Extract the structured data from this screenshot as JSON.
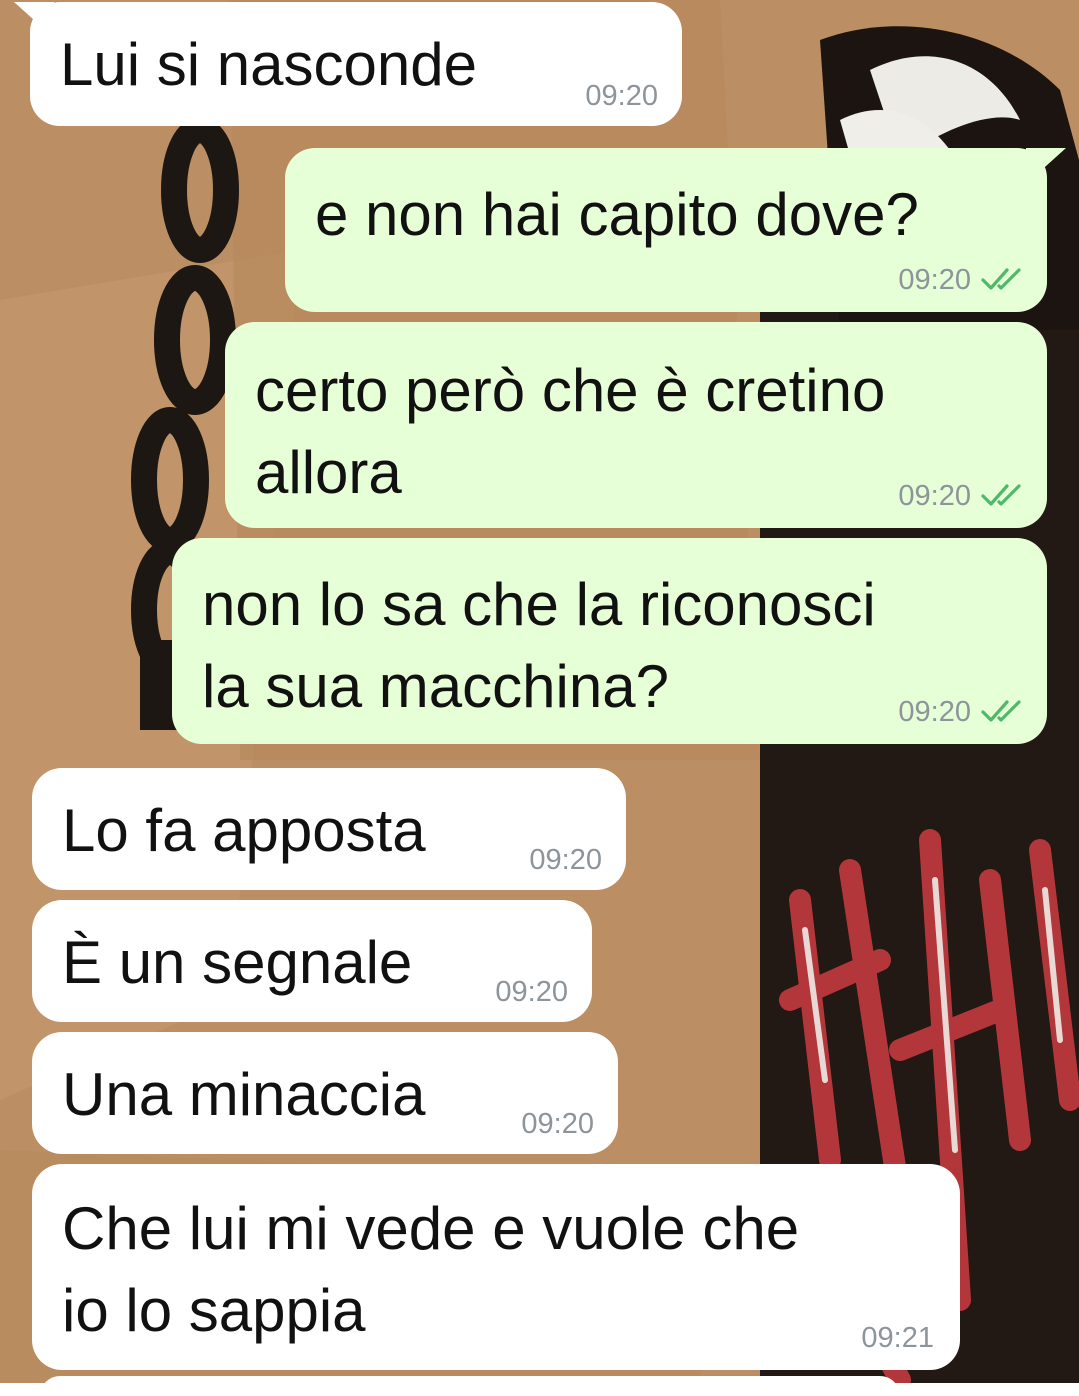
{
  "chat": {
    "messages": [
      {
        "direction": "incoming",
        "text": "Lui si nasconde",
        "time": "09:20"
      },
      {
        "direction": "outgoing",
        "text": "e non hai capito dove?",
        "time": "09:20",
        "status_icon": "double-check-icon"
      },
      {
        "direction": "outgoing",
        "text": "certo però che è cretino\nallora",
        "time": "09:20",
        "status_icon": "double-check-icon"
      },
      {
        "direction": "outgoing",
        "text": "non lo sa che la riconosci\nla sua macchina?",
        "time": "09:20",
        "status_icon": "double-check-icon"
      },
      {
        "direction": "incoming",
        "text": "Lo fa apposta",
        "time": "09:20"
      },
      {
        "direction": "incoming",
        "text": "È un segnale",
        "time": "09:20"
      },
      {
        "direction": "incoming",
        "text": "Una minaccia",
        "time": "09:20"
      },
      {
        "direction": "incoming",
        "text": "Che lui mi vede e vuole che\nio lo sappia",
        "time": "09:21"
      }
    ]
  },
  "colors": {
    "incoming_bubble": "#ffffff",
    "outgoing_bubble": "#e6ffd6",
    "timestamp": "#8d949a",
    "read_ticks": "#4fb86b",
    "wallpaper": "#b98c62"
  }
}
